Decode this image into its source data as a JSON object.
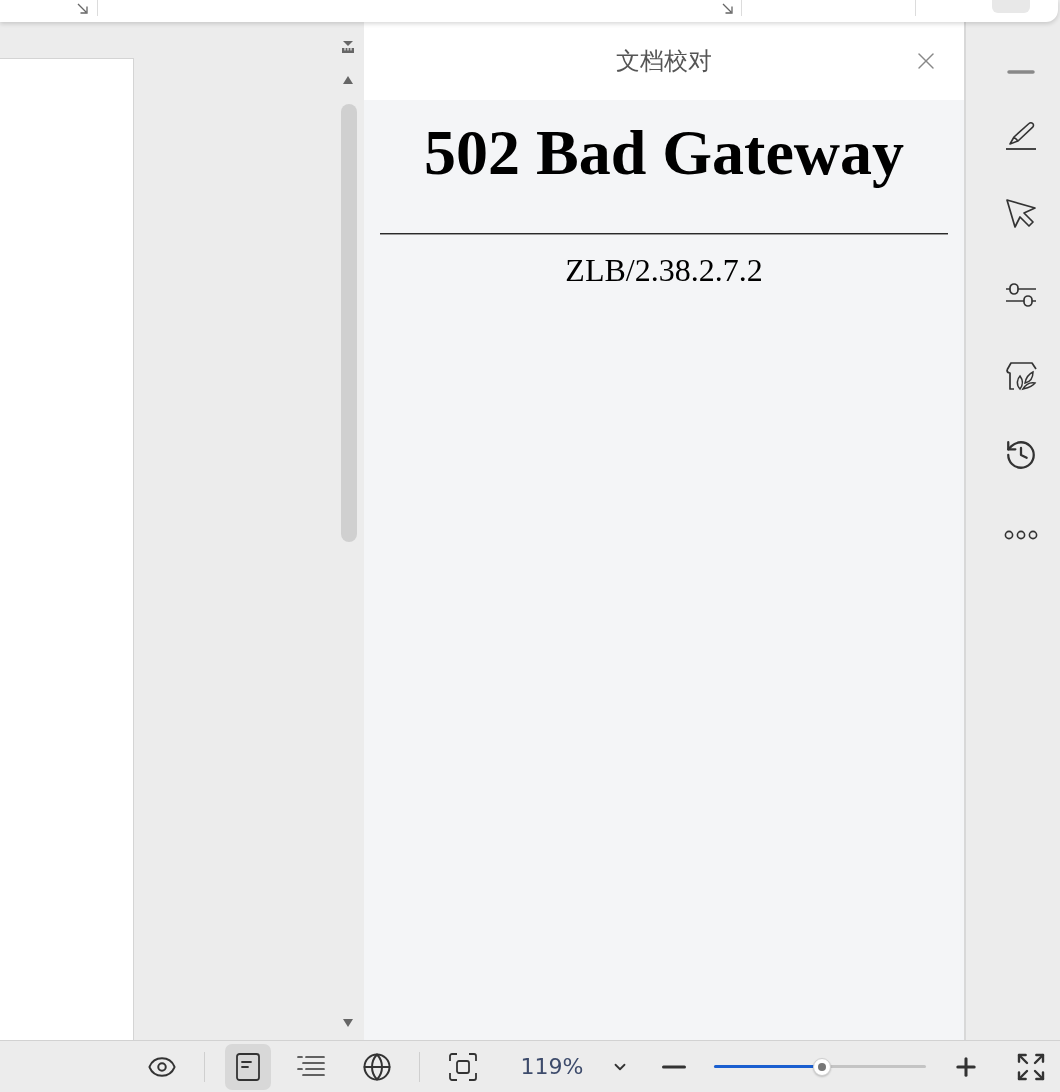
{
  "panel": {
    "title": "文档校对",
    "heading": "502 Bad Gateway",
    "server_line": "ZLB/2.38.2.7.2"
  },
  "status_bar": {
    "view_modes": [
      {
        "kind": "read",
        "selected": false
      },
      {
        "kind": "page",
        "selected": true
      },
      {
        "kind": "outline",
        "selected": false
      },
      {
        "kind": "web",
        "selected": false
      }
    ],
    "zoom": {
      "reading": "119%",
      "level": 0.51
    }
  }
}
